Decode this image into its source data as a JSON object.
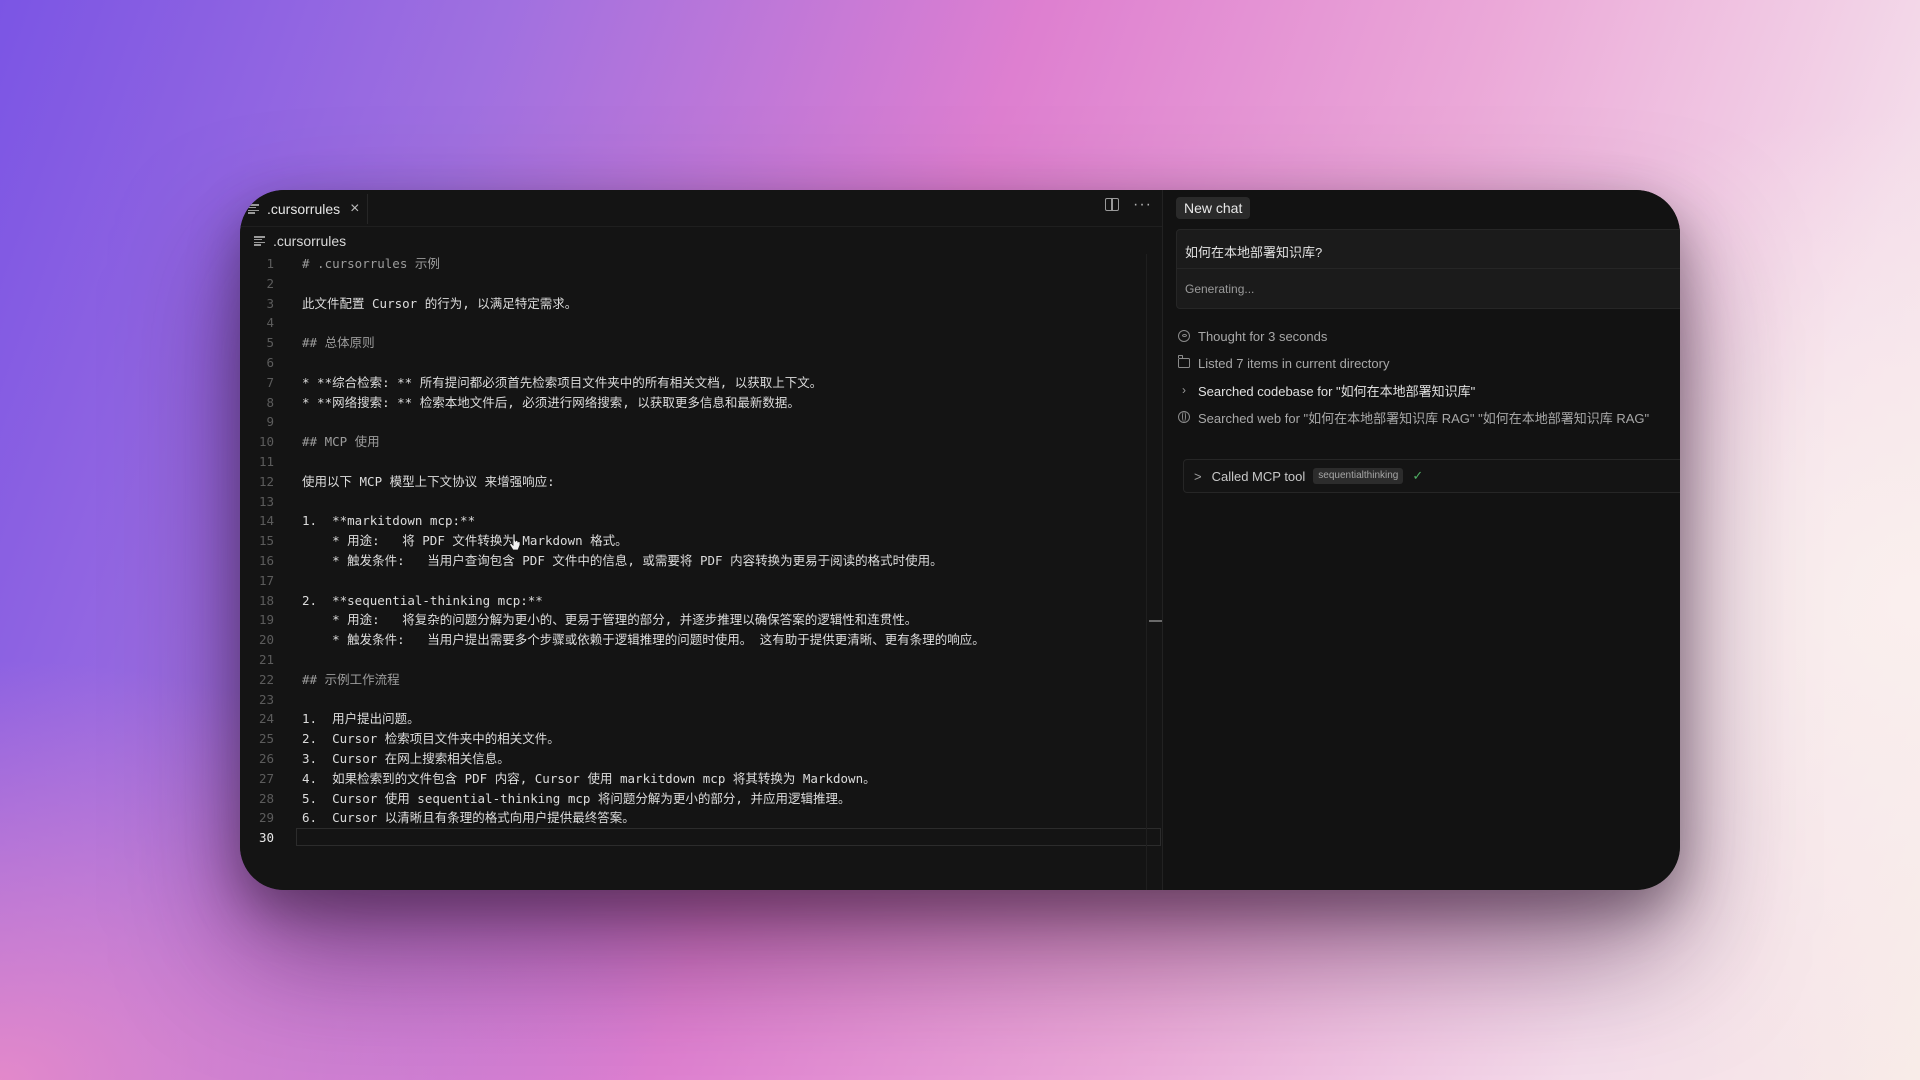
{
  "editor": {
    "tab": {
      "label": ".cursorrules",
      "close_icon": "×"
    },
    "actions": {
      "split_icon": "split-editor-icon",
      "more_label": "···"
    },
    "breadcrumb": ".cursorrules",
    "active_line": "30",
    "lines": [
      {
        "num": "1",
        "text": "# .cursorrules 示例",
        "style": "heading"
      },
      {
        "num": "2",
        "text": ""
      },
      {
        "num": "3",
        "text": "此文件配置 Cursor 的行为, 以满足特定需求。"
      },
      {
        "num": "4",
        "text": ""
      },
      {
        "num": "5",
        "text": "## 总体原则",
        "style": "heading"
      },
      {
        "num": "6",
        "text": ""
      },
      {
        "num": "7",
        "text": "* **综合检索: ** 所有提问都必须首先检索项目文件夹中的所有相关文档, 以获取上下文。"
      },
      {
        "num": "8",
        "text": "* **网络搜索: ** 检索本地文件后, 必须进行网络搜索, 以获取更多信息和最新数据。"
      },
      {
        "num": "9",
        "text": ""
      },
      {
        "num": "10",
        "text": "## MCP 使用",
        "style": "heading"
      },
      {
        "num": "11",
        "text": ""
      },
      {
        "num": "12",
        "text": "使用以下 MCP 模型上下文协议 来增强响应:"
      },
      {
        "num": "13",
        "text": ""
      },
      {
        "num": "14",
        "text": "1.  **markitdown mcp:**"
      },
      {
        "num": "15",
        "text": "    * 用途:   将 PDF 文件转换为 Markdown 格式。"
      },
      {
        "num": "16",
        "text": "    * 触发条件:   当用户查询包含 PDF 文件中的信息, 或需要将 PDF 内容转换为更易于阅读的格式时使用。"
      },
      {
        "num": "17",
        "text": ""
      },
      {
        "num": "18",
        "text": "2.  **sequential-thinking mcp:**"
      },
      {
        "num": "19",
        "text": "    * 用途:   将复杂的问题分解为更小的、更易于管理的部分, 并逐步推理以确保答案的逻辑性和连贯性。"
      },
      {
        "num": "20",
        "text": "    * 触发条件:   当用户提出需要多个步骤或依赖于逻辑推理的问题时使用。 这有助于提供更清晰、更有条理的响应。"
      },
      {
        "num": "21",
        "text": ""
      },
      {
        "num": "22",
        "text": "## 示例工作流程",
        "style": "heading"
      },
      {
        "num": "23",
        "text": ""
      },
      {
        "num": "24",
        "text": "1.  用户提出问题。"
      },
      {
        "num": "25",
        "text": "2.  Cursor 检索项目文件夹中的相关文件。"
      },
      {
        "num": "26",
        "text": "3.  Cursor 在网上搜索相关信息。"
      },
      {
        "num": "27",
        "text": "4.  如果检索到的文件包含 PDF 内容, Cursor 使用 markitdown mcp 将其转换为 Markdown。"
      },
      {
        "num": "28",
        "text": "5.  Cursor 使用 sequential-thinking mcp 将问题分解为更小的部分, 并应用逻辑推理。"
      },
      {
        "num": "29",
        "text": "6.  Cursor 以清晰且有条理的格式向用户提供最终答案。"
      },
      {
        "num": "30",
        "text": ""
      }
    ]
  },
  "chat": {
    "new_chat_label": "New chat",
    "prompt": "如何在本地部署知识库?",
    "status": "Generating...",
    "steps": {
      "thought": "Thought for 3 seconds",
      "listed": "Listed 7 items in current directory",
      "searched_codebase": "Searched codebase for \"如何在本地部署知识库\"",
      "searched_web": "Searched web for \"如何在本地部署知识库 RAG\" \"如何在本地部署知识库 RAG\""
    },
    "mcp": {
      "chevron": ">",
      "label": "Called MCP tool",
      "badge": "sequentialthinking",
      "check": "✓"
    }
  },
  "colors": {
    "window_bg": "#141414",
    "accent_check": "#4fae63"
  }
}
